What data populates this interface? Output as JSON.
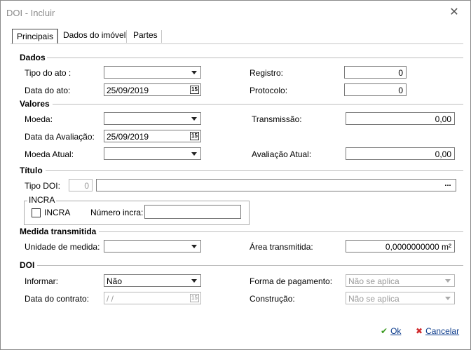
{
  "window": {
    "title": "DOI - Incluir"
  },
  "tabs": [
    {
      "label": "Principais"
    },
    {
      "label": "Dados do imóvel"
    },
    {
      "label": "Partes"
    }
  ],
  "sections": {
    "dados": "Dados",
    "valores": "Valores",
    "titulo": "Título",
    "medida": "Medida transmitida",
    "doi": "DOI"
  },
  "dados": {
    "tipo_ato_label": "Tipo do ato :",
    "tipo_ato_value": "",
    "data_ato_label": "Data do ato:",
    "data_ato_value": "25/09/2019",
    "registro_label": "Registro:",
    "registro_value": "0",
    "protocolo_label": "Protocolo:",
    "protocolo_value": "0"
  },
  "valores": {
    "moeda_label": "Moeda:",
    "moeda_value": "",
    "data_avaliacao_label": "Data da Avaliação:",
    "data_avaliacao_value": "25/09/2019",
    "moeda_atual_label": "Moeda Atual:",
    "moeda_atual_value": "",
    "transmissao_label": "Transmissão:",
    "transmissao_value": "0,00",
    "avaliacao_atual_label": "Avaliação Atual:",
    "avaliacao_atual_value": "0,00"
  },
  "titulo": {
    "tipo_doi_label": "Tipo DOI:",
    "tipo_doi_code": "0",
    "tipo_doi_desc": "",
    "ellipsis": "...",
    "incra_group": "INCRA",
    "incra_check_label": "INCRA",
    "numero_incra_label": "Número incra:",
    "numero_incra_value": ""
  },
  "medida": {
    "unidade_label": "Unidade de medida:",
    "unidade_value": "",
    "area_label": "Área transmitida:",
    "area_value": "0,0000000000 m²"
  },
  "doi": {
    "informar_label": "Informar:",
    "informar_value": "Não",
    "data_contrato_label": "Data do contrato:",
    "data_contrato_value": " /  /",
    "forma_pagamento_label": "Forma de pagamento:",
    "forma_pagamento_value": "Não se aplica",
    "construcao_label": "Construção:",
    "construcao_value": "Não se aplica"
  },
  "buttons": {
    "ok": "Ok",
    "cancel": "Cancelar"
  },
  "icons": {
    "close": "close-icon",
    "ok": "check-icon",
    "cancel": "x-icon",
    "calendar": "calendar-icon",
    "dropdown": "chevron-down-icon"
  },
  "colors": {
    "ok_icon": "#3a9a1f",
    "cancel_icon": "#d0282b",
    "link": "#0b3b8c"
  }
}
